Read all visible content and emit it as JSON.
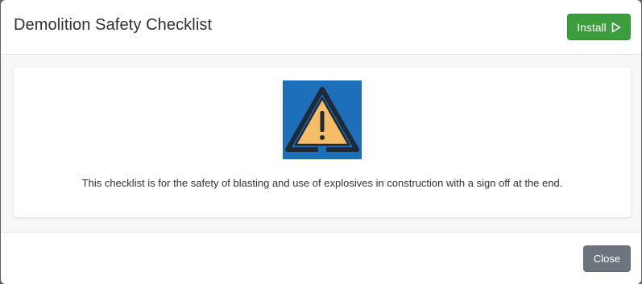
{
  "modal": {
    "title": "Demolition Safety Checklist",
    "install_label": "Install",
    "install_icon": "play-outline-icon",
    "close_label": "Close"
  },
  "app": {
    "icon": "warning-triangle-icon",
    "description": "This checklist is for the safety of blasting and use of explosives in construction with a sign off at the end."
  },
  "colors": {
    "install_button": "#3c9d3c",
    "close_button": "#6c757d",
    "icon_background": "#1c6fb8",
    "icon_triangle_fill": "#f5bd66",
    "icon_outline": "#1e2a38"
  }
}
